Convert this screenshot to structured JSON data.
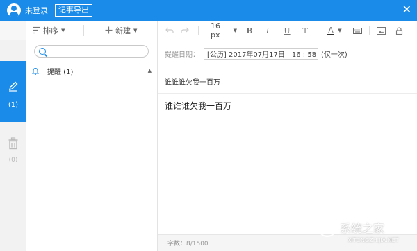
{
  "titlebar": {
    "login_text": "未登录",
    "export_label": "记事导出",
    "close_glyph": "✕",
    "color": "#1a8be8"
  },
  "list_toolbar": {
    "sort_label": "排序",
    "new_label": "新建"
  },
  "rail": {
    "notes_count": "(1)",
    "trash_count": "(0)"
  },
  "search": {
    "placeholder": ""
  },
  "groups": [
    {
      "label": "提醒 (1)",
      "icon": "bell-icon",
      "expanded": true
    }
  ],
  "editor_toolbar": {
    "font_size": "16 px",
    "bold": "B",
    "italic": "I",
    "underline": "U",
    "strike": "T",
    "font_color": "A"
  },
  "reminder": {
    "label": "提醒日期：",
    "date_value": "[公历] 2017年07月17日　16 : 58",
    "repeat": "(仅一次)"
  },
  "note": {
    "title": "谁谁谁欠我一百万",
    "body": "谁谁谁欠我一百万"
  },
  "status": {
    "word_count": "字数：8/1500"
  },
  "watermark": {
    "brand": "系统之家",
    "url": "XITONGZHIJIA.NET"
  }
}
